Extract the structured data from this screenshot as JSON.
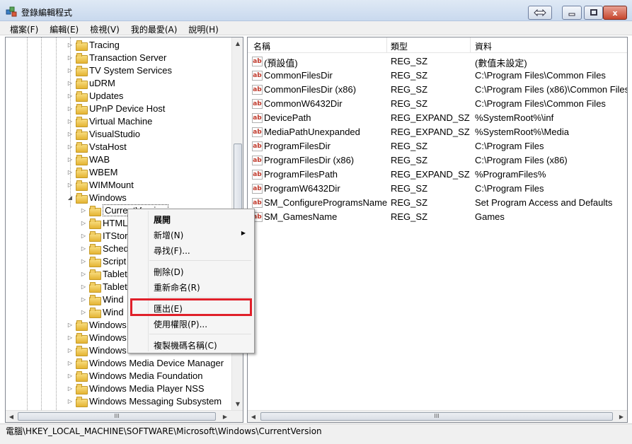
{
  "window": {
    "title": "登錄編輯程式",
    "close_glyph": "x"
  },
  "menubar": [
    {
      "label": "檔案(F)"
    },
    {
      "label": "編輯(E)"
    },
    {
      "label": "檢視(V)"
    },
    {
      "label": "我的最愛(A)"
    },
    {
      "label": "說明(H)"
    }
  ],
  "tree": {
    "items": [
      {
        "label": "Tracing"
      },
      {
        "label": "Transaction Server"
      },
      {
        "label": "TV System Services"
      },
      {
        "label": "uDRM"
      },
      {
        "label": "Updates"
      },
      {
        "label": "UPnP Device Host"
      },
      {
        "label": "Virtual Machine"
      },
      {
        "label": "VisualStudio"
      },
      {
        "label": "VstaHost"
      },
      {
        "label": "WAB"
      },
      {
        "label": "WBEM"
      },
      {
        "label": "WIMMount"
      },
      {
        "label": "Windows"
      },
      {
        "label": "CurrentVersion"
      },
      {
        "label": "HTML"
      },
      {
        "label": "ITStor"
      },
      {
        "label": "Sched"
      },
      {
        "label": "Script"
      },
      {
        "label": "Tablet"
      },
      {
        "label": "Tablet"
      },
      {
        "label": "Wind"
      },
      {
        "label": "Wind"
      },
      {
        "label": "Windows"
      },
      {
        "label": "Windows"
      },
      {
        "label": "Windows"
      },
      {
        "label": "Windows Media Device Manager"
      },
      {
        "label": "Windows Media Foundation"
      },
      {
        "label": "Windows Media Player NSS"
      },
      {
        "label": "Windows Messaging Subsystem"
      }
    ],
    "hscroll_grip": "III"
  },
  "list": {
    "columns": {
      "name": "名稱",
      "type": "類型",
      "data": "資料"
    },
    "icon_text": "ab",
    "rows": [
      {
        "name": "(預設值)",
        "type": "REG_SZ",
        "data": "(數值未設定)"
      },
      {
        "name": "CommonFilesDir",
        "type": "REG_SZ",
        "data": "C:\\Program Files\\Common Files"
      },
      {
        "name": "CommonFilesDir (x86)",
        "type": "REG_SZ",
        "data": "C:\\Program Files (x86)\\Common Files"
      },
      {
        "name": "CommonW6432Dir",
        "type": "REG_SZ",
        "data": "C:\\Program Files\\Common Files"
      },
      {
        "name": "DevicePath",
        "type": "REG_EXPAND_SZ",
        "data": "%SystemRoot%\\inf"
      },
      {
        "name": "MediaPathUnexpanded",
        "type": "REG_EXPAND_SZ",
        "data": "%SystemRoot%\\Media"
      },
      {
        "name": "ProgramFilesDir",
        "type": "REG_SZ",
        "data": "C:\\Program Files"
      },
      {
        "name": "ProgramFilesDir (x86)",
        "type": "REG_SZ",
        "data": "C:\\Program Files (x86)"
      },
      {
        "name": "ProgramFilesPath",
        "type": "REG_EXPAND_SZ",
        "data": "%ProgramFiles%"
      },
      {
        "name": "ProgramW6432Dir",
        "type": "REG_SZ",
        "data": "C:\\Program Files"
      },
      {
        "name": "SM_ConfigureProgramsName",
        "type": "REG_SZ",
        "data": "Set Program Access and Defaults"
      },
      {
        "name": "SM_GamesName",
        "type": "REG_SZ",
        "data": "Games"
      }
    ],
    "hscroll_grip": "III"
  },
  "context_menu": {
    "items": [
      {
        "label": "展開",
        "bold": true
      },
      {
        "label": "新增(N)",
        "submenu": true
      },
      {
        "label": "尋找(F)..."
      },
      {
        "label": "刪除(D)"
      },
      {
        "label": "重新命名(R)"
      },
      {
        "label": "匯出(E)",
        "highlighted": true
      },
      {
        "label": "使用權限(P)..."
      },
      {
        "label": "複製機碼名稱(C)"
      }
    ]
  },
  "statusbar": {
    "path": "電腦\\HKEY_LOCAL_MACHINE\\SOFTWARE\\Microsoft\\Windows\\CurrentVersion"
  },
  "colors": {
    "highlight_box": "#e0202a",
    "title_bar": "#c9d9ee",
    "close_button": "#c7462d"
  }
}
